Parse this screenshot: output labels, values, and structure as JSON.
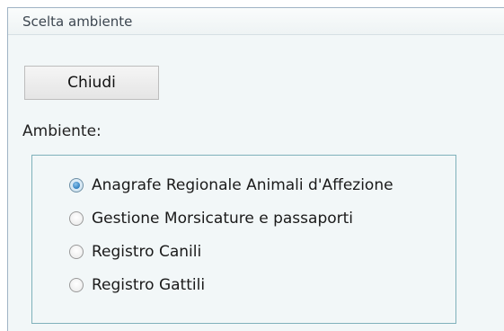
{
  "window": {
    "title": "Scelta ambiente"
  },
  "toolbar": {
    "close_label": "Chiudi"
  },
  "environment": {
    "label": "Ambiente:",
    "selected": "Anagrafe Regionale Animali d'Affezione",
    "options": [
      {
        "label": "Anagrafe Regionale Animali d'Affezione",
        "checked": true
      },
      {
        "label": "Gestione Morsicature e passaporti",
        "checked": false
      },
      {
        "label": "Registro Canili",
        "checked": false
      },
      {
        "label": "Registro Gattili",
        "checked": false
      }
    ]
  },
  "colors": {
    "panel_bg": "#f2f7f8",
    "group_border": "#7fb1bb",
    "radio_selected": "#2f7fc0"
  }
}
